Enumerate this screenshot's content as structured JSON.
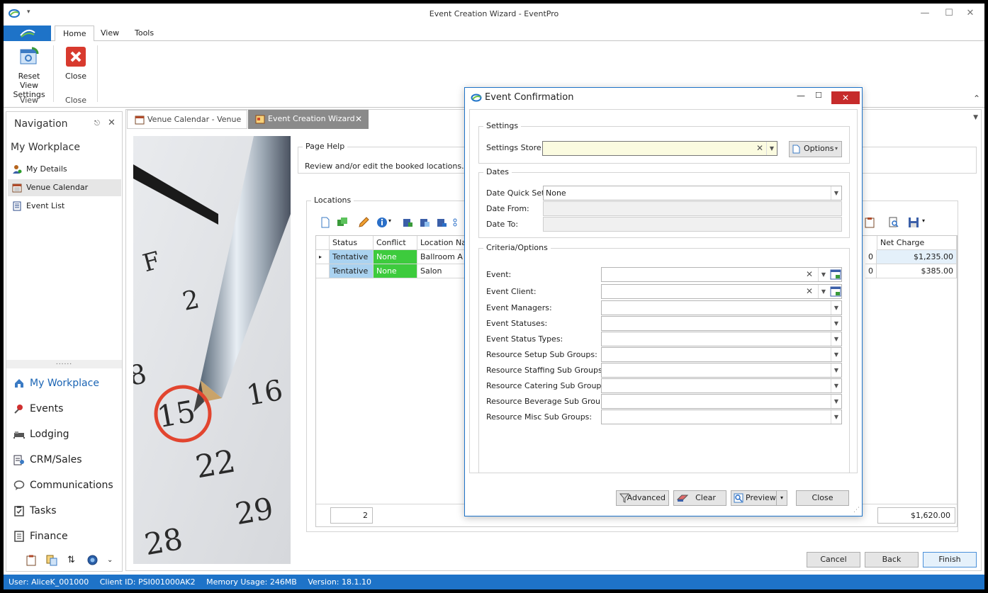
{
  "window": {
    "title": "Event Creation Wizard - EventPro",
    "minimize": "—",
    "maximize": "☐",
    "close": "✕"
  },
  "ribbon": {
    "tabs": [
      "Home",
      "View",
      "Tools"
    ],
    "buttons": {
      "reset_view": "Reset View Settings",
      "close": "Close"
    },
    "groups": {
      "view": "View",
      "close": "Close"
    }
  },
  "navigation": {
    "title": "Navigation",
    "section": "My Workplace",
    "items": [
      "My Details",
      "Venue Calendar",
      "Event List"
    ],
    "modules": [
      "My Workplace",
      "Events",
      "Lodging",
      "CRM/Sales",
      "Communications",
      "Tasks",
      "Finance"
    ],
    "splitter": "......"
  },
  "document": {
    "tabs": [
      "Venue Calendar - Venue",
      "Event Creation Wizard"
    ],
    "page_help_legend": "Page Help",
    "page_help_text": "Review and/or edit the booked locations.",
    "locations_legend": "Locations",
    "grid": {
      "columns": [
        "Status",
        "Conflict",
        "Location Nam",
        "Net Charge"
      ],
      "rows": [
        {
          "status": "Tentative",
          "conflict": "None",
          "location": "Ballroom A",
          "qty": "0",
          "net_charge": "$1,235.00"
        },
        {
          "status": "Tentative",
          "conflict": "None",
          "location": "Salon",
          "qty": "0",
          "net_charge": "$385.00"
        }
      ],
      "count": "2",
      "total": "$1,620.00"
    },
    "photo_numbers": [
      "F",
      "2",
      "8",
      "15",
      "16",
      "22",
      "29",
      "28"
    ],
    "buttons": {
      "cancel": "Cancel",
      "back": "Back",
      "finish": "Finish"
    }
  },
  "dialog": {
    "title": "Event Confirmation",
    "settings_legend": "Settings",
    "settings_store_label": "Settings Store:",
    "options_label": "Options",
    "dates_legend": "Dates",
    "date_quick_set_label": "Date Quick Set:",
    "date_quick_set_value": "None",
    "date_from_label": "Date From:",
    "date_to_label": "Date To:",
    "criteria_legend": "Criteria/Options",
    "criteria": [
      "Event:",
      "Event Client:",
      "Event Managers:",
      "Event Statuses:",
      "Event Status Types:",
      "Resource Setup Sub Groups:",
      "Resource Staffing Sub Groups:",
      "Resource Catering Sub Groups:",
      "Resource Beverage Sub Groups:",
      "Resource Misc Sub Groups:"
    ],
    "buttons": {
      "advanced": "Advanced",
      "clear": "Clear",
      "preview": "Preview",
      "close": "Close"
    }
  },
  "status_bar": {
    "user": "User: AliceK_001000",
    "client": "Client ID: PSI001000AK2",
    "memory": "Memory Usage: 246MB",
    "version": "Version: 18.1.10"
  },
  "colors": {
    "accent": "#1e73c8",
    "tentative": "#aad2f0",
    "conflict_none": "#3dcb3d",
    "dialog_close": "#c62b2b"
  }
}
